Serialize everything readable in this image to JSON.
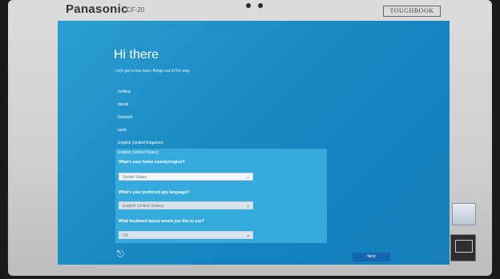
{
  "device": {
    "brand": "Panasonic",
    "model": "CF-20",
    "badge": "TOUGHBOOK"
  },
  "setup": {
    "title": "Hi there",
    "subtitle": "Let's get a few basic things out of the way.",
    "languages": [
      "čeština",
      "dansk",
      "Deutsch",
      "eesti",
      "English (United Kingdom)"
    ],
    "selected_language": "English (United States)",
    "country_question": "What's your home country/region?",
    "country_value": "United States",
    "app_language_question": "What's your preferred app language?",
    "app_language_value": "English (United States)",
    "keyboard_question": "What keyboard layout would you like to use?",
    "keyboard_value": "US",
    "next_label": "Next"
  },
  "colors": {
    "screen_blue": "#1a89c2",
    "panel_blue": "#36a9dd",
    "next_button": "#1366b0"
  }
}
